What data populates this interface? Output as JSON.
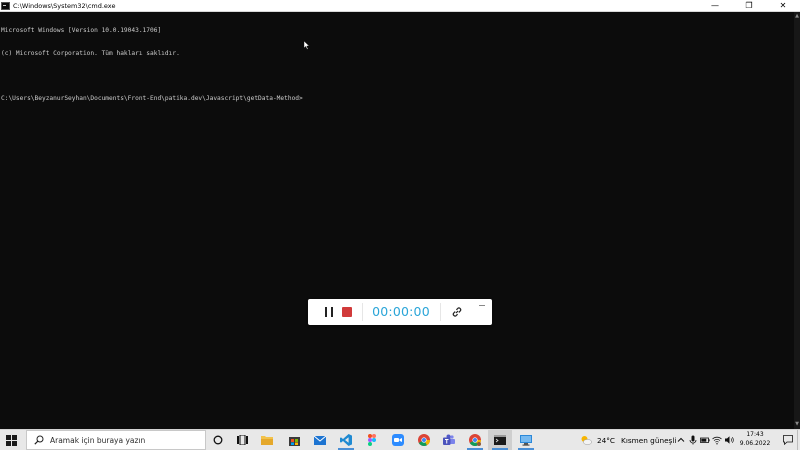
{
  "window": {
    "title": "C:\\Windows\\System32\\cmd.exe",
    "controls": {
      "minimize": "—",
      "restore": "❐",
      "close": "✕"
    }
  },
  "console": {
    "lines": [
      "Microsoft Windows [Version 10.0.19043.1706]",
      "(c) Microsoft Corporation. Tüm hakları saklıdır.",
      "",
      "C:\\Users\\BeyzanurSeyhan\\Documents\\Front-End\\patika.dev\\Javascript\\getData-Method>"
    ]
  },
  "recorder": {
    "timer": "00:00:00",
    "colors": {
      "timer": "#2aa5d8",
      "stop": "#d13a3a"
    },
    "icons": [
      "pause-icon",
      "stop-icon",
      "link-icon",
      "minimize-icon"
    ]
  },
  "taskbar": {
    "search_placeholder": "Aramak için buraya yazın",
    "pinned_icons": [
      "cortana-icon",
      "task-view-icon",
      "file-explorer-icon",
      "store-icon",
      "mail-icon",
      "vscode-icon",
      "figma-icon",
      "zoom-icon",
      "chrome-icon",
      "teams-icon",
      "chrome-profile-icon",
      "cmd-icon",
      "remote-desktop-icon"
    ],
    "accent_color": "#4a8fd6"
  },
  "tray": {
    "temperature": "24°C",
    "condition": "Kısmen güneşli",
    "time": "17:43",
    "date": "9.06.2022"
  }
}
